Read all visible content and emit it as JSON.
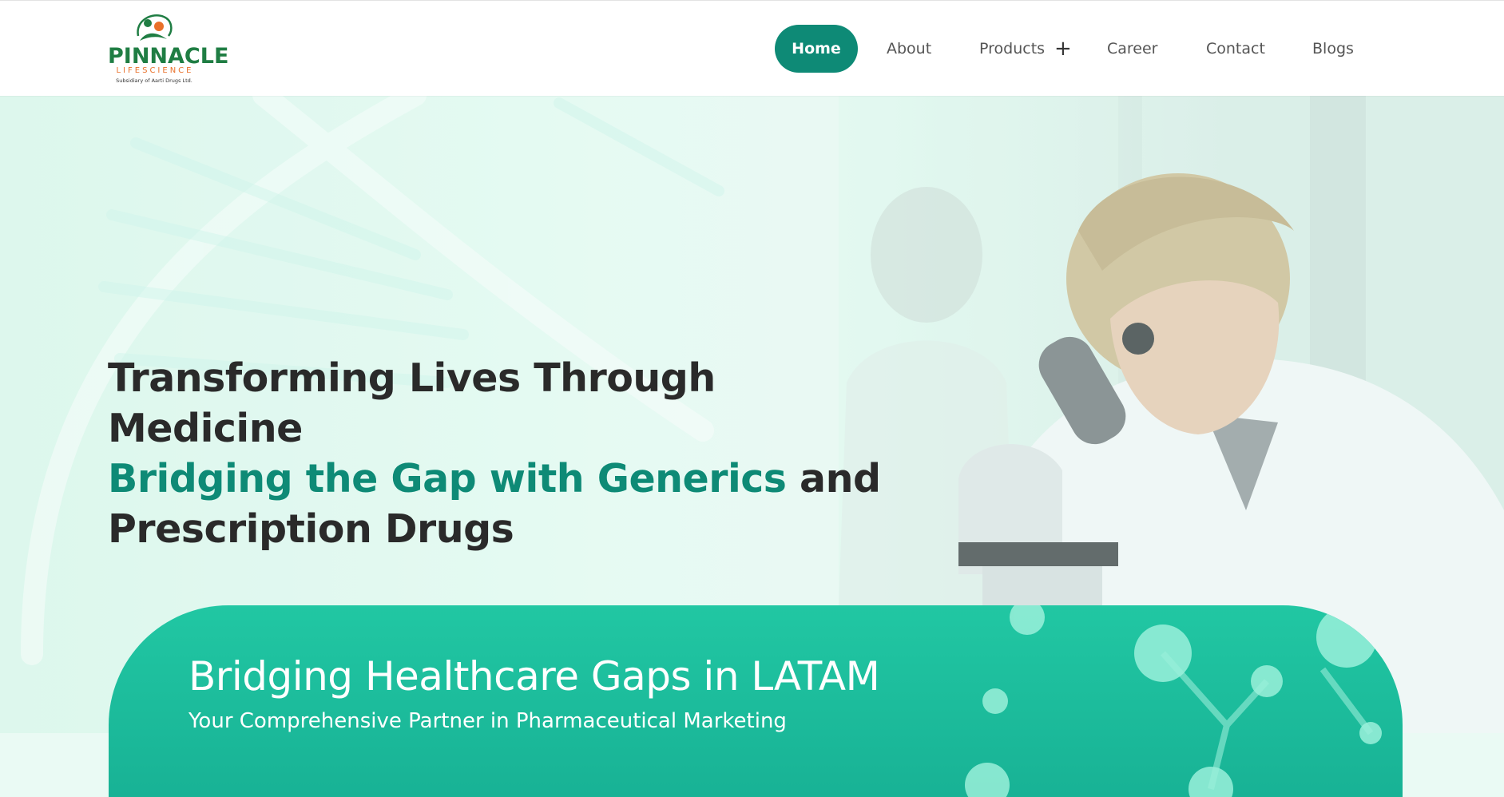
{
  "header": {
    "logo": {
      "brand": "PINNACLE",
      "sub": "LIFESCIENCE",
      "tagline": "Subsidiary of Aarti Drugs Ltd."
    },
    "nav": [
      {
        "label": "Home",
        "active": true
      },
      {
        "label": "About"
      },
      {
        "label": "Products",
        "icon": "plus-icon"
      },
      {
        "label": "Career"
      },
      {
        "label": "Contact"
      },
      {
        "label": "Blogs"
      }
    ]
  },
  "hero": {
    "line1": "Transforming Lives Through Medicine",
    "line2_accent": "Bridging the Gap with Generics",
    "line2_rest": " and",
    "line3": "Prescription Drugs"
  },
  "banner": {
    "title": "Bridging Healthcare Gaps in LATAM",
    "subtitle": "Your Comprehensive Partner in Pharmaceutical Marketing"
  },
  "colors": {
    "accent": "#0e8a76",
    "banner": "#1fc3a0",
    "brand_green": "#1f7d43",
    "brand_orange": "#e9702a",
    "text": "#2a2a2a"
  }
}
